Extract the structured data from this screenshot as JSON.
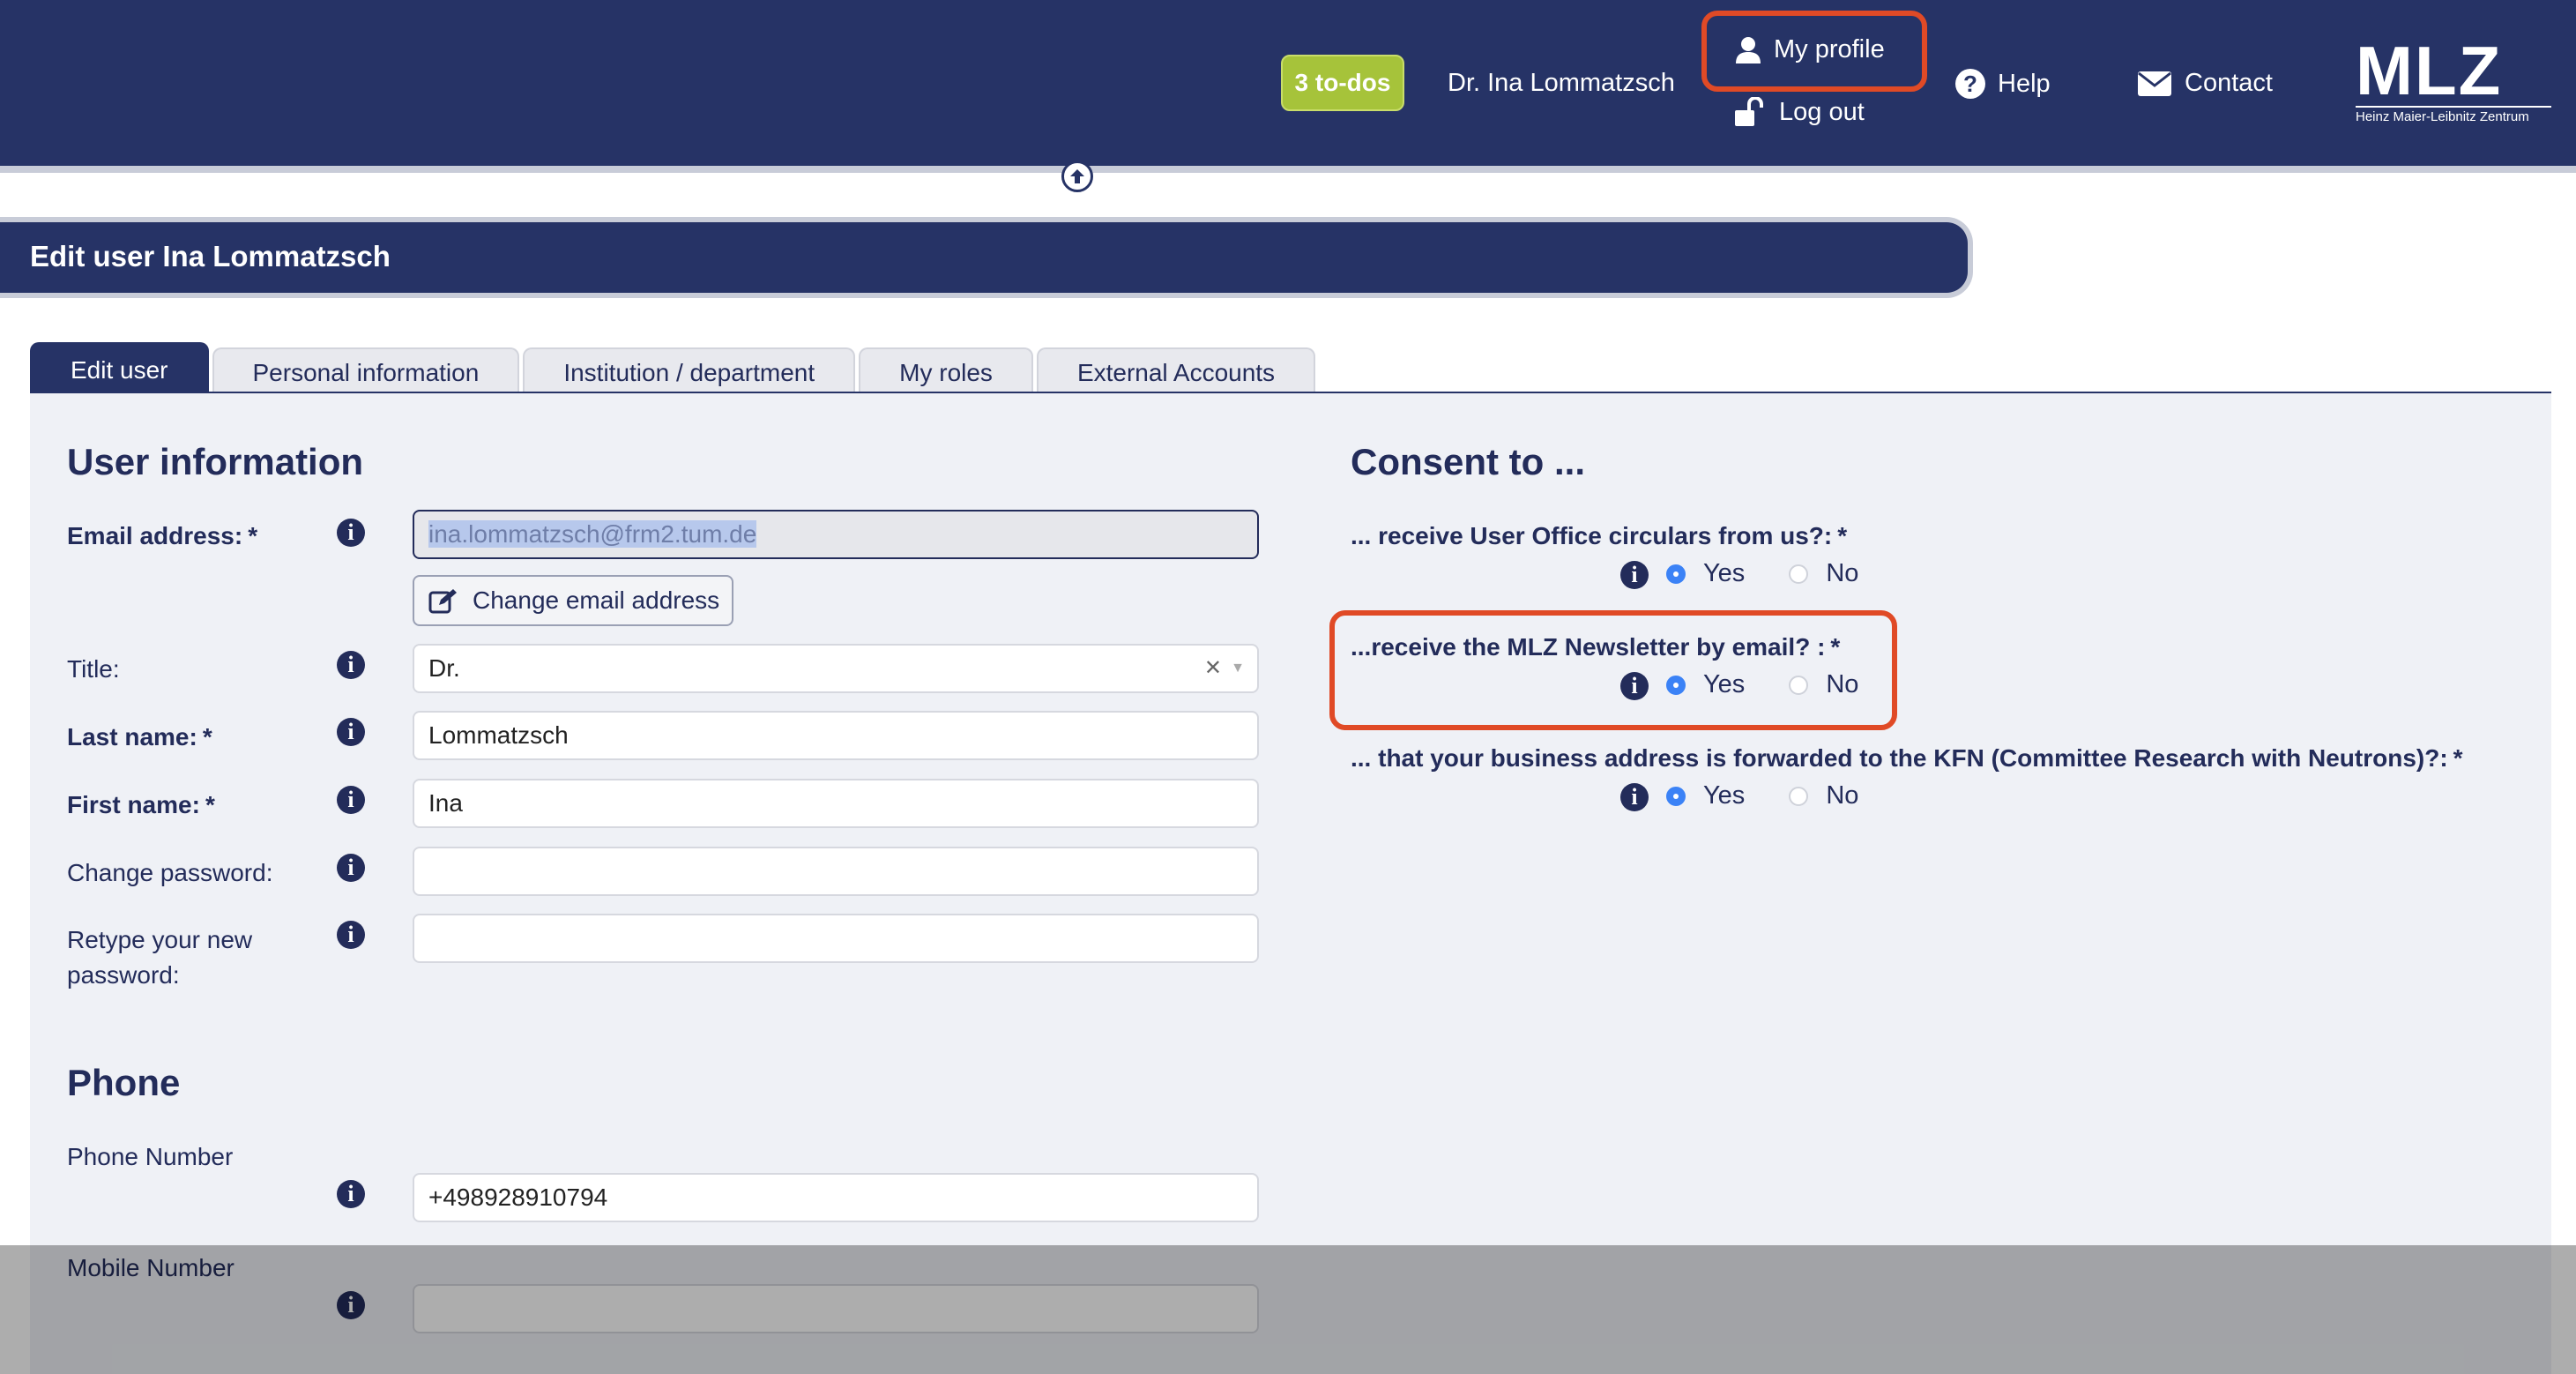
{
  "header": {
    "todos": "3 to-dos",
    "user_name": "Dr. Ina Lommatzsch",
    "my_profile": "My profile",
    "logout": "Log out",
    "help": "Help",
    "contact": "Contact",
    "logo_text": "MLZ",
    "logo_sub": "Heinz Maier-Leibnitz Zentrum"
  },
  "page_title": "Edit user Ina Lommatzsch",
  "tabs": [
    "Edit user",
    "Personal information",
    "Institution / department",
    "My roles",
    "External Accounts"
  ],
  "user_info": {
    "heading": "User information",
    "email_label": "Email address:",
    "email_value": "ina.lommatzsch@frm2.tum.de",
    "change_email_button": "Change email address",
    "title_label": "Title:",
    "title_value": "Dr.",
    "last_name_label": "Last name:",
    "last_name_value": "Lommatzsch",
    "first_name_label": "First name:",
    "first_name_value": "Ina",
    "change_password_label": "Change password:",
    "retype_label_line1": "Retype your new",
    "retype_label_line2": "password:",
    "required_mark": "*"
  },
  "phone": {
    "heading": "Phone",
    "phone_label": "Phone Number",
    "phone_value": "+498928910794",
    "mobile_label": "Mobile Number",
    "mobile_value": ""
  },
  "consent": {
    "heading": "Consent to ...",
    "questions": [
      {
        "text": "... receive User Office circulars from us?:",
        "yes": "Yes",
        "no": "No",
        "selected": "Yes"
      },
      {
        "text": "...receive the MLZ Newsletter by email? :",
        "yes": "Yes",
        "no": "No",
        "selected": "Yes"
      },
      {
        "text": "... that your business address is forwarded to the KFN (Committee Research with Neutrons)?:",
        "yes": "Yes",
        "no": "No",
        "selected": "Yes"
      }
    ]
  },
  "colors": {
    "header_bg": "#263366",
    "todo_badge": "#a6c33a",
    "highlight": "#e04a26",
    "radio_checked": "#3b82f6"
  },
  "icons": {
    "user": "user-icon",
    "logout": "unlock-icon",
    "help": "help-icon",
    "contact": "envelope-icon",
    "info": "info-icon",
    "edit": "edit-icon",
    "collapse": "arrow-up-icon"
  }
}
